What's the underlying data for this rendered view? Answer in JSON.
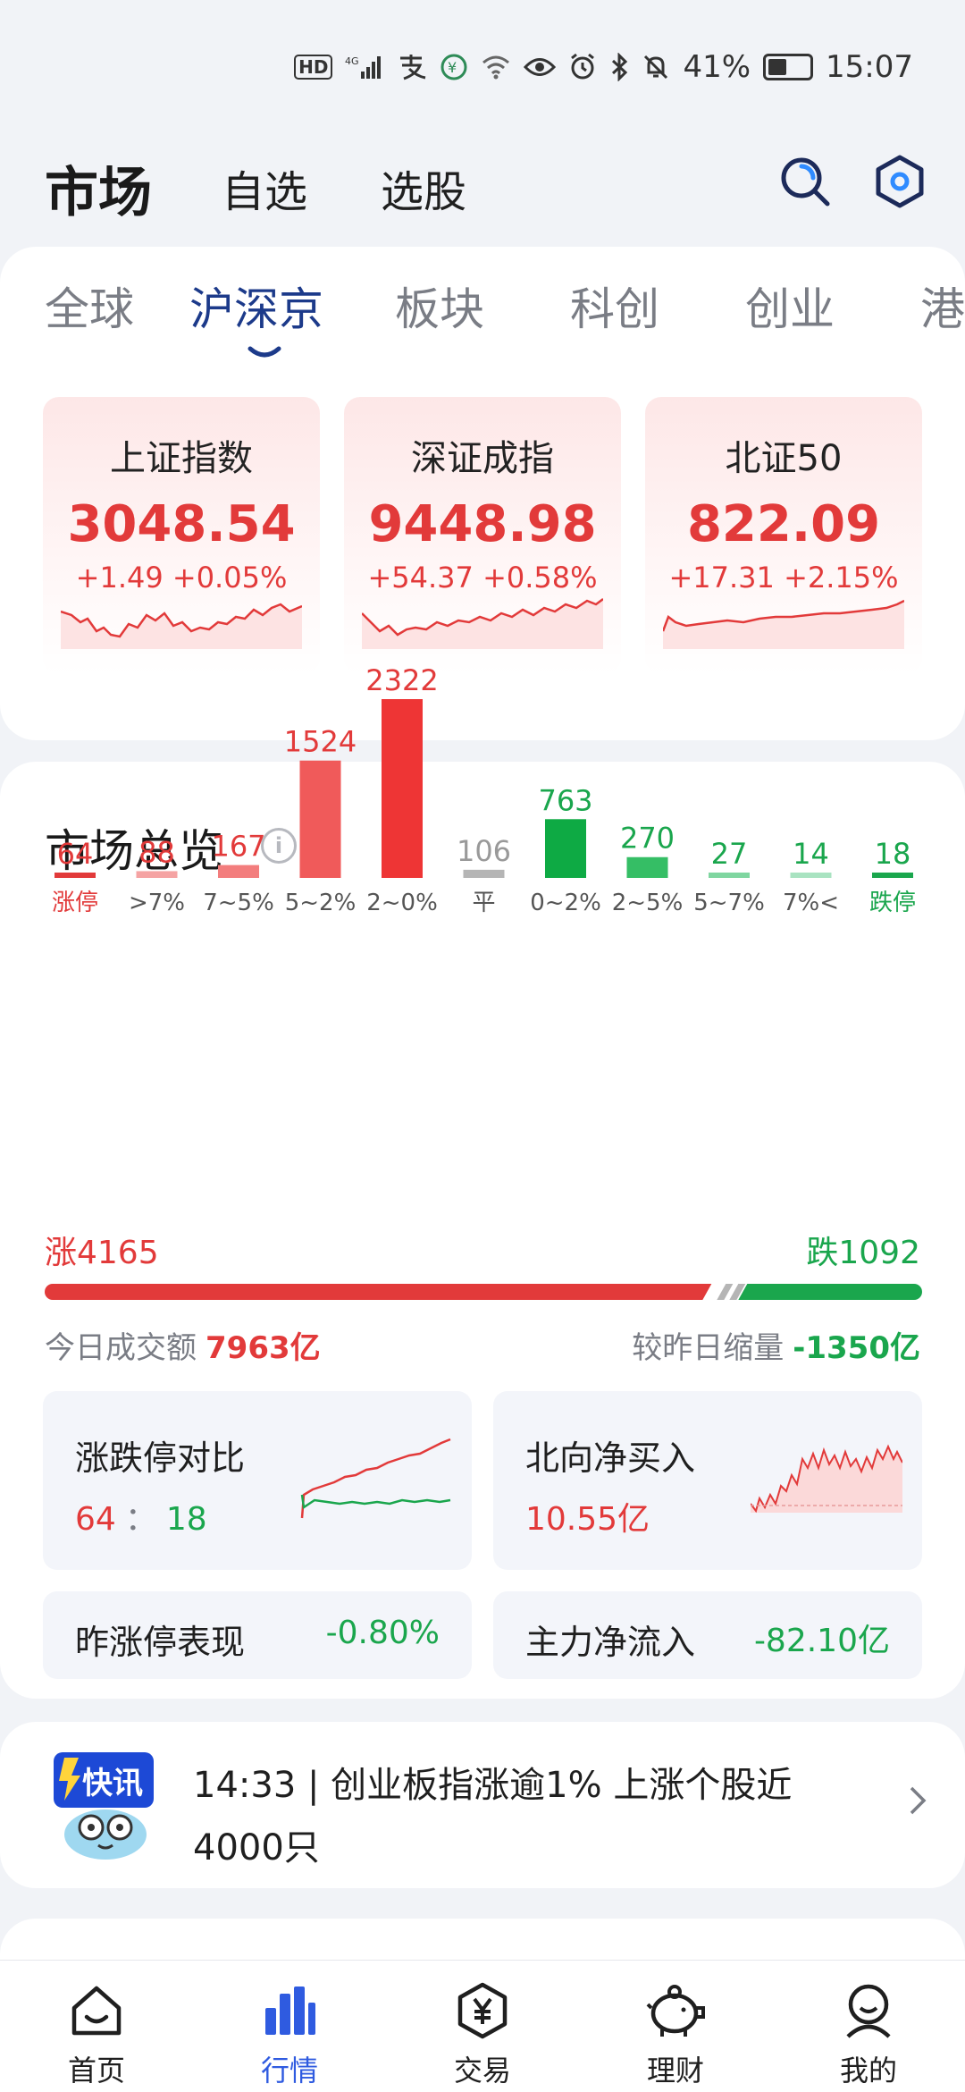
{
  "status_bar": {
    "hd": "HD",
    "network": "4G",
    "battery": "41%",
    "time": "15:07"
  },
  "header": {
    "title": "市场",
    "tabs": [
      "自选",
      "选股"
    ],
    "icons": [
      "search-icon",
      "settings-hexagon-icon"
    ]
  },
  "market_tabs": [
    "全球",
    "沪深京",
    "板块",
    "科创",
    "创业",
    "港"
  ],
  "active_market_tab": "沪深京",
  "indices": [
    {
      "name": "上证指数",
      "value": "3048.54",
      "change": "+1.49",
      "pct": "+0.05%"
    },
    {
      "name": "深证成指",
      "value": "9448.98",
      "change": "+54.37",
      "pct": "+0.58%"
    },
    {
      "name": "北证50",
      "value": "822.09",
      "change": "+17.31",
      "pct": "+2.15%"
    }
  ],
  "overview": {
    "title": "市场总览",
    "info_icon": "info-icon",
    "up_label": "涨4165",
    "down_label": "跌1092",
    "turnover_label": "今日成交额",
    "turnover_value": "7963亿",
    "compare_label": "较昨日缩量",
    "compare_value": "-1350亿",
    "limit_compare": {
      "title": "涨跌停对比",
      "up": "64",
      "sep": "：",
      "down": "18"
    },
    "northbound": {
      "title": "北向净买入",
      "value": "10.55亿"
    },
    "yesterday_limit": {
      "title": "昨涨停表现",
      "value": "-0.80%"
    },
    "main_flow": {
      "title": "主力净流入",
      "value": "-82.10亿"
    }
  },
  "chart_data": {
    "type": "bar",
    "categories": [
      "涨停",
      ">7%",
      "7~5%",
      "5~2%",
      "2~0%",
      "平",
      "0~2%",
      "2~5%",
      "5~7%",
      "7%<",
      "跌停"
    ],
    "values": [
      64,
      88,
      167,
      1524,
      2322,
      106,
      763,
      270,
      27,
      14,
      18
    ],
    "colors": [
      "#e23a3a",
      "#f5a3a3",
      "#f37d7d",
      "#f05a5a",
      "#ee3535",
      "#b5b5b5",
      "#0eaa44",
      "#35be65",
      "#7fd6a0",
      "#a9e3c1",
      "#1aa64d"
    ],
    "label_colors": [
      "#e23a3a",
      "#e23a3a",
      "#e23a3a",
      "#e23a3a",
      "#e23a3a",
      "#999999",
      "#1aa64d",
      "#1aa64d",
      "#1aa64d",
      "#1aa64d",
      "#1aa64d"
    ],
    "title": "",
    "xlabel": "",
    "ylabel": "",
    "ylim": [
      0,
      2322
    ]
  },
  "up_down_ratio": {
    "up": 4165,
    "down": 1092
  },
  "news": {
    "logo_label": "快讯",
    "text": "14:33 | 创业板指涨逾1% 上涨个股近4000只"
  },
  "bottom_nav": [
    {
      "label": "首页",
      "icon": "home-icon"
    },
    {
      "label": "行情",
      "icon": "market-bars-icon"
    },
    {
      "label": "交易",
      "icon": "trade-yen-icon"
    },
    {
      "label": "理财",
      "icon": "piggy-bank-icon"
    },
    {
      "label": "我的",
      "icon": "profile-icon"
    }
  ],
  "colors": {
    "up": "#e23a3a",
    "down": "#1aa64d",
    "accent": "#2f5be0",
    "tab_active": "#1c3a8a"
  }
}
